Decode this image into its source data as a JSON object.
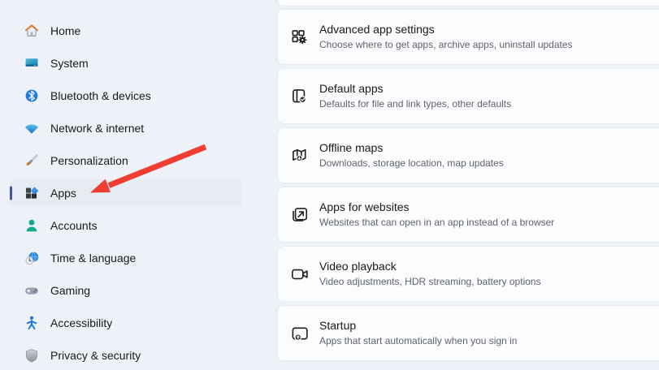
{
  "sidebar": {
    "items": [
      {
        "label": "Home",
        "icon": "home-icon",
        "selected": false
      },
      {
        "label": "System",
        "icon": "system-icon",
        "selected": false
      },
      {
        "label": "Bluetooth & devices",
        "icon": "bluetooth-icon",
        "selected": false
      },
      {
        "label": "Network & internet",
        "icon": "network-icon",
        "selected": false
      },
      {
        "label": "Personalization",
        "icon": "personalization-icon",
        "selected": false
      },
      {
        "label": "Apps",
        "icon": "apps-icon",
        "selected": true
      },
      {
        "label": "Accounts",
        "icon": "accounts-icon",
        "selected": false
      },
      {
        "label": "Time & language",
        "icon": "time-language-icon",
        "selected": false
      },
      {
        "label": "Gaming",
        "icon": "gaming-icon",
        "selected": false
      },
      {
        "label": "Accessibility",
        "icon": "accessibility-icon",
        "selected": false
      },
      {
        "label": "Privacy & security",
        "icon": "privacy-security-icon",
        "selected": false
      }
    ]
  },
  "main": {
    "cards": [
      {
        "title": "Advanced app settings",
        "subtitle": "Choose where to get apps, archive apps, uninstall updates",
        "icon": "advanced-app-settings-icon"
      },
      {
        "title": "Default apps",
        "subtitle": "Defaults for file and link types, other defaults",
        "icon": "default-apps-icon"
      },
      {
        "title": "Offline maps",
        "subtitle": "Downloads, storage location, map updates",
        "icon": "offline-maps-icon"
      },
      {
        "title": "Apps for websites",
        "subtitle": "Websites that can open in an app instead of a browser",
        "icon": "apps-for-websites-icon"
      },
      {
        "title": "Video playback",
        "subtitle": "Video adjustments, HDR streaming, battery options",
        "icon": "video-playback-icon"
      },
      {
        "title": "Startup",
        "subtitle": "Apps that start automatically when you sign in",
        "icon": "startup-icon"
      }
    ]
  },
  "annotation": {
    "arrow_points_to": "Apps",
    "arrow_color": "#f03c31"
  },
  "colors": {
    "page_bg": "#eef2f8",
    "card_bg": "#fbfcfd",
    "card_border": "#e7eaf0",
    "selected_item_bg": "#e7ebf2",
    "accent_bar": "#44549e"
  }
}
